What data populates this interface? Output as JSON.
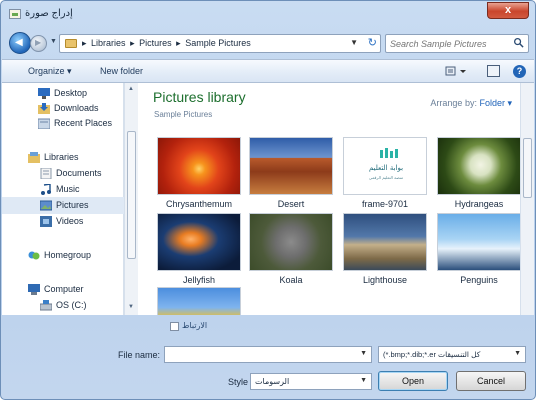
{
  "window": {
    "title": "إدراج صورة",
    "close_label": "x"
  },
  "nav": {
    "breadcrumbs": [
      "Libraries",
      "Pictures",
      "Sample Pictures"
    ],
    "separator": "▸",
    "search_placeholder": "Search Sample Pictures"
  },
  "toolbar": {
    "organize_label": "Organize ▾",
    "new_folder_label": "New folder",
    "help_label": "?"
  },
  "sidebar": {
    "items": [
      {
        "label": "Desktop",
        "icon": "desktop-icon"
      },
      {
        "label": "Downloads",
        "icon": "downloads-icon"
      },
      {
        "label": "Recent Places",
        "icon": "recent-places-icon"
      },
      {
        "label": "Libraries",
        "icon": "libraries-icon"
      },
      {
        "label": "Documents",
        "icon": "documents-icon"
      },
      {
        "label": "Music",
        "icon": "music-icon"
      },
      {
        "label": "Pictures",
        "icon": "pictures-icon"
      },
      {
        "label": "Videos",
        "icon": "videos-icon"
      },
      {
        "label": "Homegroup",
        "icon": "homegroup-icon"
      },
      {
        "label": "Computer",
        "icon": "computer-icon"
      },
      {
        "label": "OS (C:)",
        "icon": "drive-icon"
      }
    ]
  },
  "library": {
    "title": "Pictures library",
    "subtitle": "Sample Pictures",
    "arrange_label": "Arrange by:",
    "arrange_value": "Folder ▾"
  },
  "files": [
    {
      "name": "Chrysanthemum"
    },
    {
      "name": "Desert"
    },
    {
      "name": "frame-9701"
    },
    {
      "name": "Hydrangeas"
    },
    {
      "name": "Jellyfish"
    },
    {
      "name": "Koala"
    },
    {
      "name": "Lighthouse"
    },
    {
      "name": "Penguins"
    },
    {
      "name": ""
    }
  ],
  "frame_logo": {
    "arabic": "بوابة التعليم",
    "sub": "منصة التعليم الرقمي"
  },
  "footer": {
    "link_checkbox_label": "الارتباط",
    "file_name_label": "File name:",
    "file_name_value": "",
    "filter_value": "(*.bmp;*.dib;*.er كل التنسيقات",
    "style_label": "Style",
    "style_value": "الرسومات",
    "open_label": "Open",
    "cancel_label": "Cancel"
  }
}
